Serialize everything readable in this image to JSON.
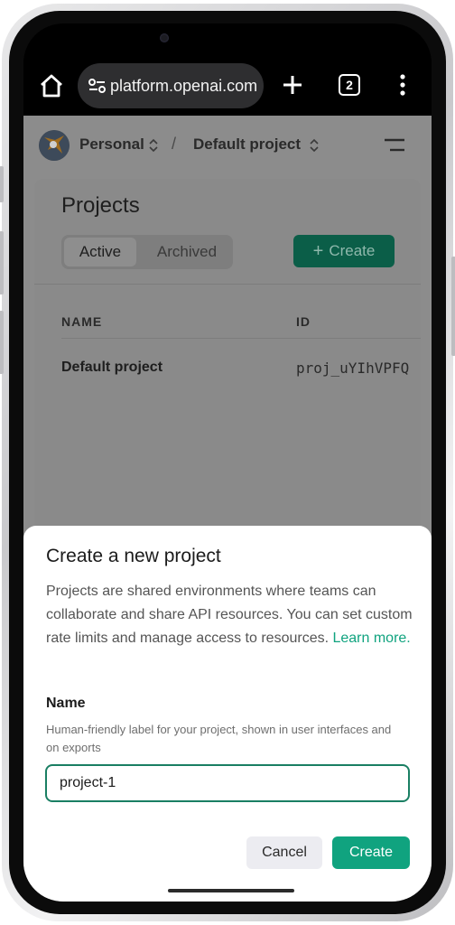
{
  "browser": {
    "url": "platform.openai.com",
    "tab_count": "2"
  },
  "topnav": {
    "org_name": "Personal",
    "separator": "/",
    "project_name": "Default project"
  },
  "projects_card": {
    "title": "Projects",
    "tabs": [
      {
        "label": "Active",
        "selected": true
      },
      {
        "label": "Archived",
        "selected": false
      }
    ],
    "create_label": "Create",
    "columns": [
      "NAME",
      "ID"
    ],
    "rows": [
      {
        "name": "Default project",
        "id": "proj_uYIhVPFQ"
      }
    ]
  },
  "sheet": {
    "title": "Create a new project",
    "description": "Projects are shared environments where teams can collaborate and share API resources. You can set custom rate limits and manage access to resources.",
    "learn_more": "Learn more.",
    "name_label": "Name",
    "name_help": "Human-friendly label for your project, shown in user interfaces and on exports",
    "name_value": "project-1",
    "cancel_label": "Cancel",
    "create_label": "Create"
  },
  "colors": {
    "accent": "#10a37f",
    "input_border": "#1a7f63",
    "dimmed_background": "#8c8c8c"
  }
}
